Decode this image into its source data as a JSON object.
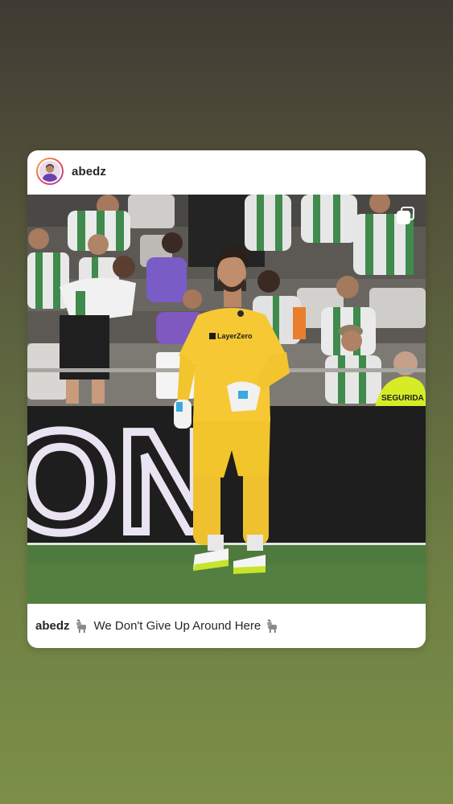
{
  "post": {
    "username": "abedz",
    "caption_user": "abedz",
    "caption_text": "We Don't Give Up Around Here",
    "caption_emoji_name": "goat-icon",
    "shirt_sponsor": "LayerZero",
    "board_text": "ON",
    "steward_vest_text": "SEGURIDA"
  },
  "icons": {
    "avatar": "avatar-photo",
    "multi_post": "multi-post-icon"
  },
  "colors": {
    "kit_yellow": "#f2c530",
    "pitch_green": "#4f7a3e",
    "card_bg": "#ffffff",
    "text": "#262626"
  }
}
